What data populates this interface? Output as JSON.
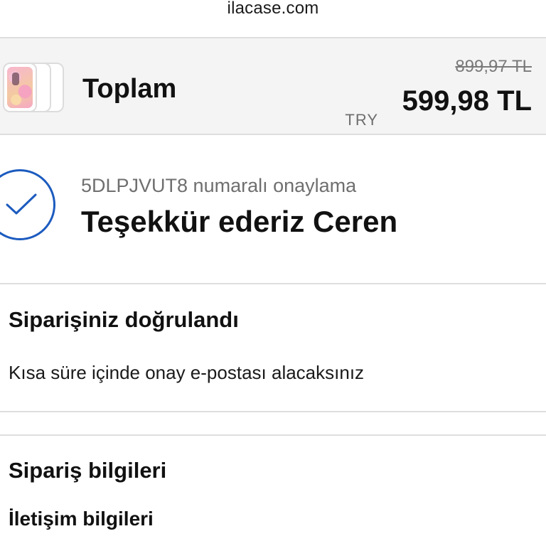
{
  "browser": {
    "url": "ilacase.com"
  },
  "summary": {
    "total_label": "Toplam",
    "original_price": "899,97 TL",
    "currency_code": "TRY",
    "total_price": "599,98 TL",
    "product_image": "phone-case-thumbnail"
  },
  "confirmation": {
    "number_text": "5DLPJVUT8 numaralı onaylama",
    "thanks_text": "Teşekkür ederiz Ceren",
    "icon": "checkmark-circle-icon",
    "accent_color": "#1c5bbf"
  },
  "order_verified": {
    "title": "Siparişiniz doğrulandı",
    "description": "Kısa süre içinde onay e-postası alacaksınız"
  },
  "order_details": {
    "title": "Sipariş bilgileri",
    "contact_heading": "İletişim bilgileri"
  }
}
